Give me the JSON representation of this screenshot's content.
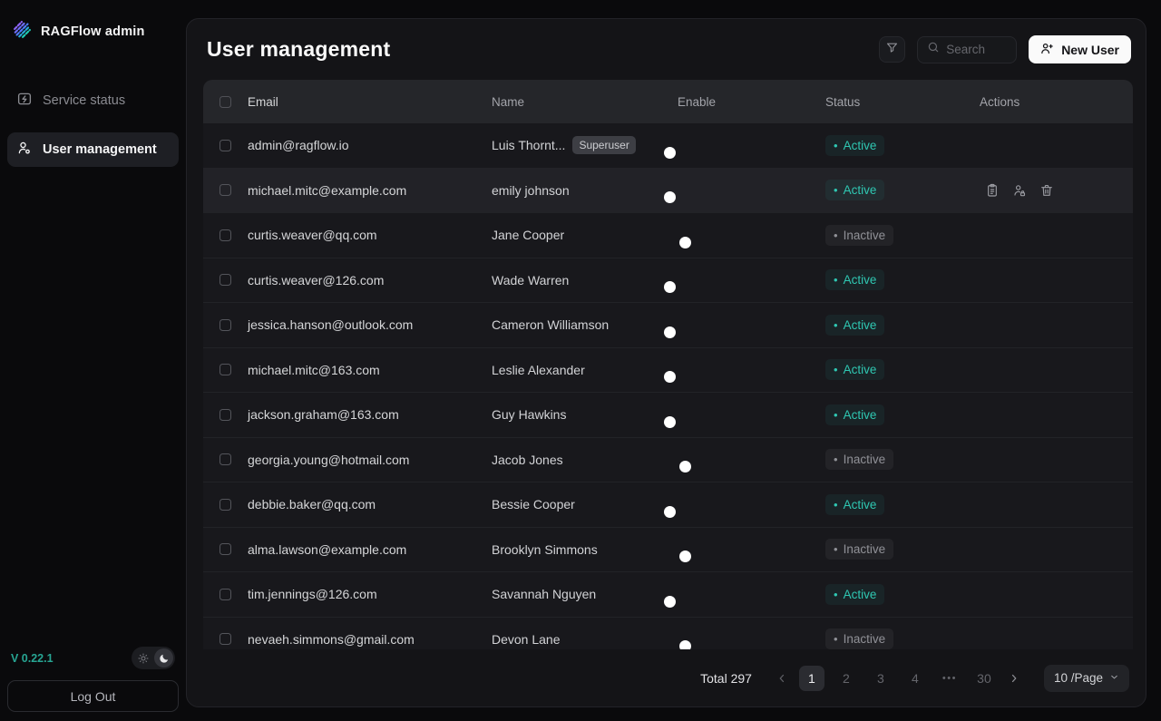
{
  "sidebar": {
    "brand": "RAGFlow admin",
    "items": [
      {
        "label": "Service status",
        "icon": "service-status-icon",
        "active": false
      },
      {
        "label": "User management",
        "icon": "user-management-icon",
        "active": true
      }
    ],
    "version": "V 0.22.1",
    "logout_label": "Log Out",
    "theme": {
      "options": [
        "light",
        "dark"
      ],
      "selected": "dark"
    }
  },
  "header": {
    "title": "User management",
    "search": {
      "placeholder": "Search"
    },
    "new_user_label": "New User"
  },
  "table": {
    "columns": [
      "Email",
      "Name",
      "Enable",
      "Status",
      "Actions"
    ],
    "superuser_badge": "Superuser",
    "row_actions": [
      "clipboard-icon",
      "user-lock-icon",
      "trash-icon"
    ],
    "rows": [
      {
        "email": "admin@ragflow.io",
        "name": "Luis Thornt...",
        "superuser": true,
        "enabled": true,
        "status": "Active",
        "hovered": false
      },
      {
        "email": "michael.mitc@example.com",
        "name": "emily johnson",
        "superuser": false,
        "enabled": true,
        "status": "Active",
        "hovered": true
      },
      {
        "email": "curtis.weaver@qq.com",
        "name": "Jane Cooper",
        "superuser": false,
        "enabled": false,
        "status": "Inactive",
        "hovered": false
      },
      {
        "email": "curtis.weaver@126.com",
        "name": "Wade Warren",
        "superuser": false,
        "enabled": true,
        "status": "Active",
        "hovered": false
      },
      {
        "email": "jessica.hanson@outlook.com",
        "name": "Cameron Williamson",
        "superuser": false,
        "enabled": true,
        "status": "Active",
        "hovered": false
      },
      {
        "email": "michael.mitc@163.com",
        "name": "Leslie Alexander",
        "superuser": false,
        "enabled": true,
        "status": "Active",
        "hovered": false
      },
      {
        "email": "jackson.graham@163.com",
        "name": "Guy Hawkins",
        "superuser": false,
        "enabled": true,
        "status": "Active",
        "hovered": false
      },
      {
        "email": "georgia.young@hotmail.com",
        "name": "Jacob Jones",
        "superuser": false,
        "enabled": false,
        "status": "Inactive",
        "hovered": false
      },
      {
        "email": "debbie.baker@qq.com",
        "name": "Bessie Cooper",
        "superuser": false,
        "enabled": true,
        "status": "Active",
        "hovered": false
      },
      {
        "email": "alma.lawson@example.com",
        "name": "Brooklyn Simmons",
        "superuser": false,
        "enabled": false,
        "status": "Inactive",
        "hovered": false
      },
      {
        "email": "tim.jennings@126.com",
        "name": "Savannah Nguyen",
        "superuser": false,
        "enabled": true,
        "status": "Active",
        "hovered": false
      },
      {
        "email": "nevaeh.simmons@gmail.com",
        "name": "Devon Lane",
        "superuser": false,
        "enabled": false,
        "status": "Inactive",
        "hovered": false
      }
    ]
  },
  "pagination": {
    "total_label": "Total 297",
    "pages": [
      "1",
      "2",
      "3",
      "4",
      "•••",
      "30"
    ],
    "active_page": "1",
    "page_size_label": "10 /Page"
  },
  "colors": {
    "accent_teal": "#1ec3ac",
    "active_status_text": "#2fc7b2",
    "new_user_button_bg": "#fafafa",
    "panel_bg": "#141417",
    "table_header_bg": "#25262a"
  }
}
